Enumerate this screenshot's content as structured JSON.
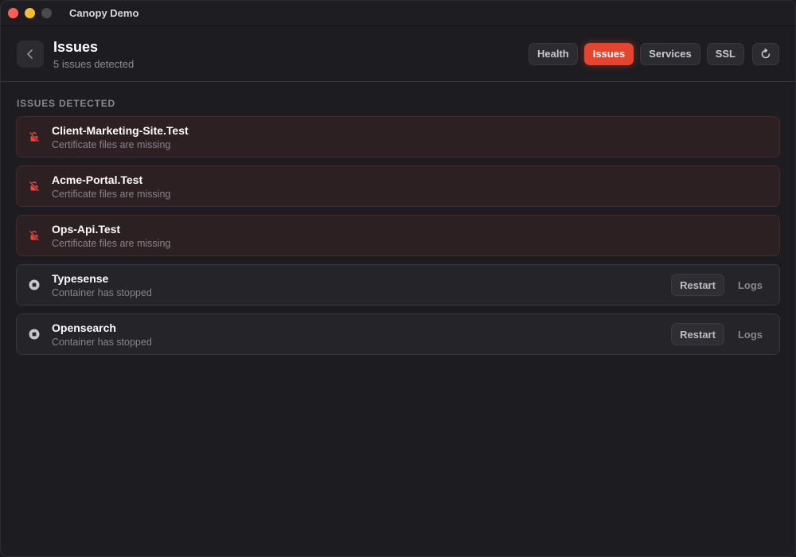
{
  "window": {
    "title": "Canopy Demo"
  },
  "header": {
    "title": "Issues",
    "subtitle": "5 issues detected"
  },
  "nav": {
    "tabs": [
      {
        "label": "Health",
        "active": false
      },
      {
        "label": "Issues",
        "active": true
      },
      {
        "label": "Services",
        "active": false
      },
      {
        "label": "SSL",
        "active": false
      }
    ],
    "refresh_icon": "refresh-icon"
  },
  "section": {
    "title": "ISSUES DETECTED"
  },
  "issues": [
    {
      "name": "Client-Marketing-Site.Test",
      "description": "Certificate files are missing",
      "kind": "ssl",
      "icon": "unlocked-icon"
    },
    {
      "name": "Acme-Portal.Test",
      "description": "Certificate files are missing",
      "kind": "ssl",
      "icon": "unlocked-icon"
    },
    {
      "name": "Ops-Api.Test",
      "description": "Certificate files are missing",
      "kind": "ssl",
      "icon": "unlocked-icon"
    },
    {
      "name": "Typesense",
      "description": "Container has stopped",
      "kind": "service",
      "icon": "stop-icon",
      "restart_label": "Restart",
      "logs_label": "Logs"
    },
    {
      "name": "Opensearch",
      "description": "Container has stopped",
      "kind": "service",
      "icon": "stop-icon",
      "restart_label": "Restart",
      "logs_label": "Logs"
    }
  ],
  "colors": {
    "accent": "#e5452f",
    "ssl_icon": "#f0433a",
    "service_icon": "#c8c7cc"
  }
}
